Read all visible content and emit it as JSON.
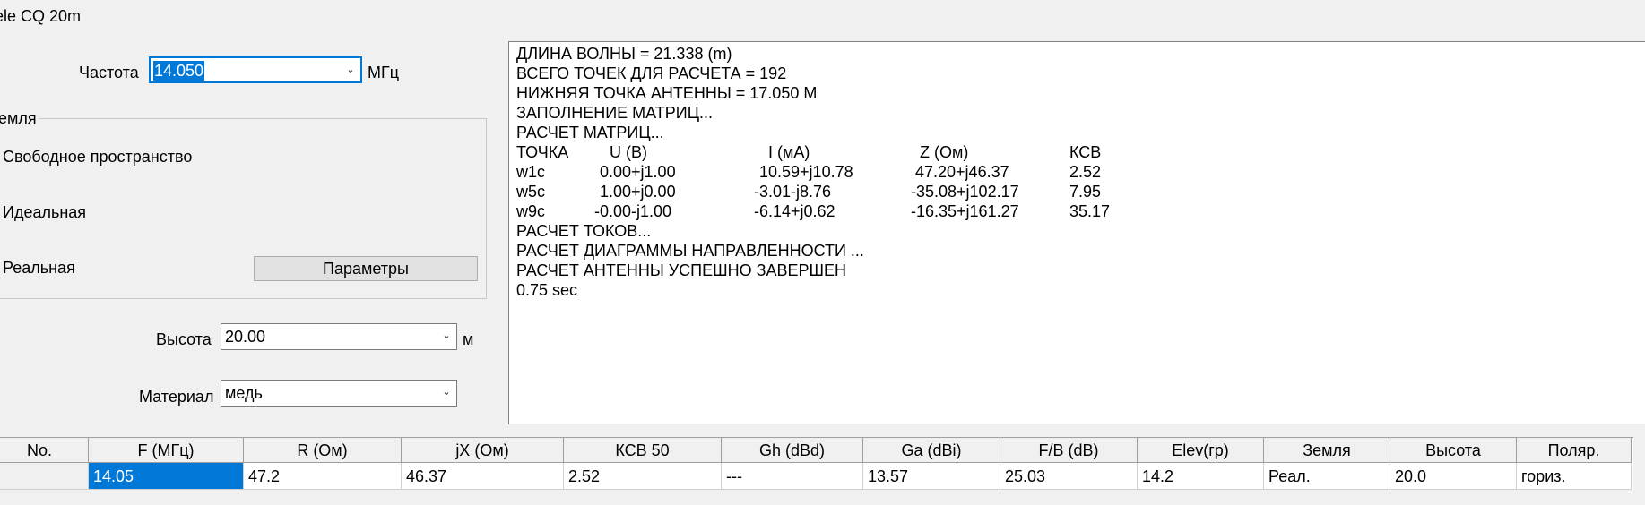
{
  "window": {
    "title": "ele CQ 20m"
  },
  "frequency": {
    "label": "Частота",
    "value": "14.050",
    "unit": "МГц"
  },
  "ground": {
    "title": "емля",
    "options": [
      "Свободное пространство",
      "Идеальная",
      "Реальная"
    ],
    "params_button": "Параметры"
  },
  "height": {
    "label": "Высота",
    "value": "20.00",
    "unit": "м"
  },
  "material": {
    "label": "Материал",
    "value": "медь"
  },
  "output": {
    "lines_top": [
      "ДЛИНА ВОЛНЫ = 21.338 (m)",
      "ВСЕГО ТОЧЕК ДЛЯ РАСЧЕТА = 192",
      "НИЖНЯЯ ТОЧКА АНТЕННЫ = 17.050 М",
      "ЗАПОЛНЕНИЕ МАТРИЦ...",
      "РАСЧЕТ МАТРИЦ..."
    ],
    "table_header": [
      "ТОЧКА",
      "U (B)",
      "I (мА)",
      "Z (Ом)",
      "КСВ"
    ],
    "table_rows": [
      [
        "w1c",
        "0.00+j1.00",
        "10.59+j10.78",
        "47.20+j46.37",
        "2.52"
      ],
      [
        "w5c",
        "1.00+j0.00",
        "-3.01-j8.76",
        "-35.08+j102.17",
        "7.95"
      ],
      [
        "w9c",
        "-0.00-j1.00",
        "-6.14+j0.62",
        "-16.35+j161.27",
        "35.17"
      ]
    ],
    "lines_bottom": [
      "РАСЧЕТ ТОКОВ...",
      "РАСЧЕТ ДИАГРАММЫ НАПРАВЛЕННОСТИ ...",
      "РАСЧЕТ АНТЕННЫ УСПЕШНО ЗАВЕРШЕН",
      "0.75 sec"
    ]
  },
  "results": {
    "columns": [
      "No.",
      "F (МГц)",
      "R (Ом)",
      "jX (Ом)",
      "КСВ 50",
      "Gh (dBd)",
      "Ga (dBi)",
      "F/B (dB)",
      "Elev(гр)",
      "Земля",
      "Высота",
      "Поляр."
    ],
    "row": [
      "",
      "14.05",
      "47.2",
      "46.37",
      "2.52",
      "---",
      "13.57",
      "25.03",
      "14.2",
      "Реал.",
      "20.0",
      "гориз."
    ]
  }
}
